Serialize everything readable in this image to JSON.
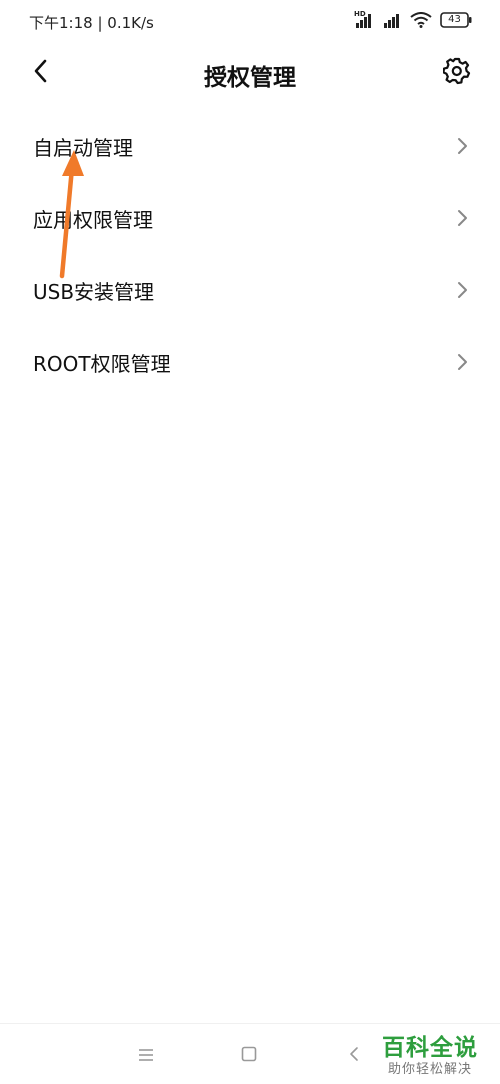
{
  "status_bar": {
    "time_speed": "下午1:18 | 0.1K/s",
    "battery": "43",
    "network_label": "HD"
  },
  "header": {
    "title": "授权管理"
  },
  "menu_items": [
    {
      "label": "自启动管理"
    },
    {
      "label": "应用权限管理"
    },
    {
      "label": "USB安装管理"
    },
    {
      "label": "ROOT权限管理"
    }
  ],
  "annotation": {
    "color": "#f07a2a"
  },
  "watermark": {
    "main": "百科全说",
    "sub": "助你轻松解决"
  },
  "icons": {
    "back": "back-arrow-icon",
    "settings": "gear-icon",
    "chevron": "chevron-right-icon",
    "nav_menu": "menu-icon",
    "nav_home": "home-square-icon",
    "nav_back": "back-triangle-icon"
  }
}
